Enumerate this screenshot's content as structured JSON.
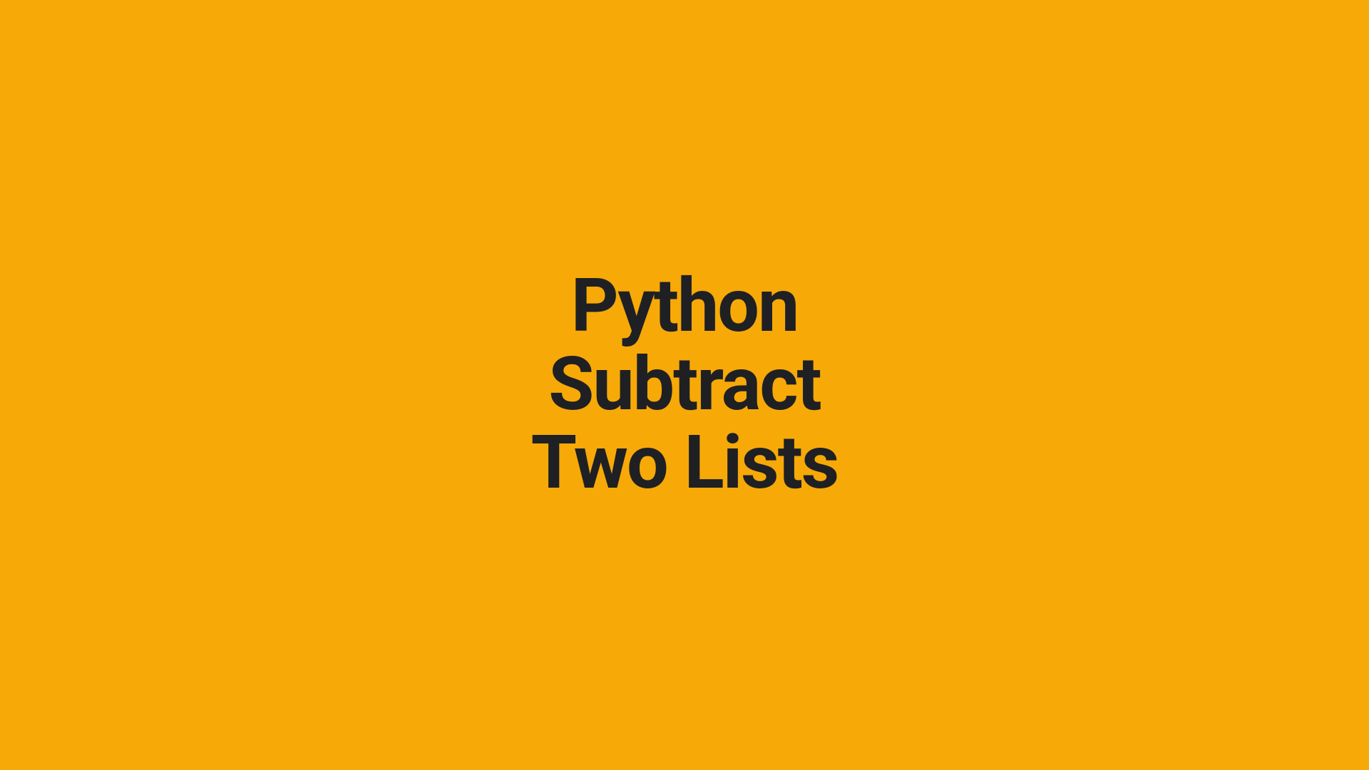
{
  "title": {
    "line1": "Python",
    "line2": "Subtract",
    "line3": "Two Lists"
  },
  "colors": {
    "background": "#F7A908",
    "text": "#1F2023"
  }
}
